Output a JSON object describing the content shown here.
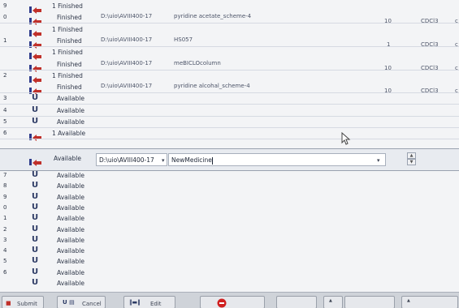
{
  "rows_top": [
    {
      "idx": "9",
      "status": "1 Finished",
      "finished": true,
      "dir": "",
      "name": "",
      "num": "",
      "solvent": "",
      "extra": ""
    },
    {
      "idx": "0",
      "status": "Finished",
      "finished": true,
      "dir": "D:\\uio\\AVIII400-17",
      "name": "pyridine acetate_scheme-4",
      "num": "10",
      "solvent": "CDCl3",
      "extra": "c"
    },
    {
      "idx": "",
      "status": "1 Finished",
      "finished": true,
      "dir": "",
      "name": "",
      "num": "",
      "solvent": "",
      "extra": ""
    },
    {
      "idx": "1",
      "status": "Finished",
      "finished": true,
      "dir": "D:\\uio\\AVIII400-17",
      "name": "HS057",
      "num": "1",
      "solvent": "CDCl3",
      "extra": "c"
    },
    {
      "idx": "",
      "status": "1 Finished",
      "finished": true,
      "dir": "",
      "name": "",
      "num": "",
      "solvent": "",
      "extra": ""
    },
    {
      "idx": "",
      "status": "Finished",
      "finished": true,
      "dir": "D:\\uio\\AVIII400-17",
      "name": "meBICLOcolumn",
      "num": "10",
      "solvent": "CDCl3",
      "extra": "c"
    },
    {
      "idx": "2",
      "status": "1 Finished",
      "finished": true,
      "dir": "",
      "name": "",
      "num": "",
      "solvent": "",
      "extra": ""
    },
    {
      "idx": "",
      "status": "Finished",
      "finished": true,
      "dir": "D:\\uio\\AVIII400-17",
      "name": "pyridine alcohal_scheme-4",
      "num": "10",
      "solvent": "CDCl3",
      "extra": "c"
    },
    {
      "idx": "3",
      "status": "Available",
      "finished": false,
      "dir": "",
      "name": "",
      "num": "",
      "solvent": "",
      "extra": ""
    },
    {
      "idx": "4",
      "status": "Available",
      "finished": false,
      "dir": "",
      "name": "",
      "num": "",
      "solvent": "",
      "extra": ""
    },
    {
      "idx": "5",
      "status": "Available",
      "finished": false,
      "dir": "",
      "name": "",
      "num": "",
      "solvent": "",
      "extra": ""
    },
    {
      "idx": "6",
      "status": "1 Available",
      "finished": true,
      "dir": "",
      "name": "",
      "num": "",
      "solvent": "",
      "extra": ""
    }
  ],
  "edit_row": {
    "status": "Available",
    "directory": "D:\\uio\\AVIII400-17",
    "name": "NewMedicine"
  },
  "rows_bottom": [
    {
      "idx": "7",
      "status": "Available"
    },
    {
      "idx": "8",
      "status": "Available"
    },
    {
      "idx": "9",
      "status": "Available"
    },
    {
      "idx": "0",
      "status": "Available"
    },
    {
      "idx": "1",
      "status": "Available"
    },
    {
      "idx": "2",
      "status": "Available"
    },
    {
      "idx": "3",
      "status": "Available"
    },
    {
      "idx": "4",
      "status": "Available"
    },
    {
      "idx": "5",
      "status": "Available"
    },
    {
      "idx": "6",
      "status": "Available"
    },
    {
      "idx": "",
      "status": "Available"
    }
  ],
  "footer": {
    "submit_label": "Submit",
    "cancel_label": "Cancel",
    "edit_label": "Edit"
  },
  "colors": {
    "finished_icon": "#c0302a",
    "available_icon": "#2c3a64",
    "background": "#f3f4f6"
  }
}
